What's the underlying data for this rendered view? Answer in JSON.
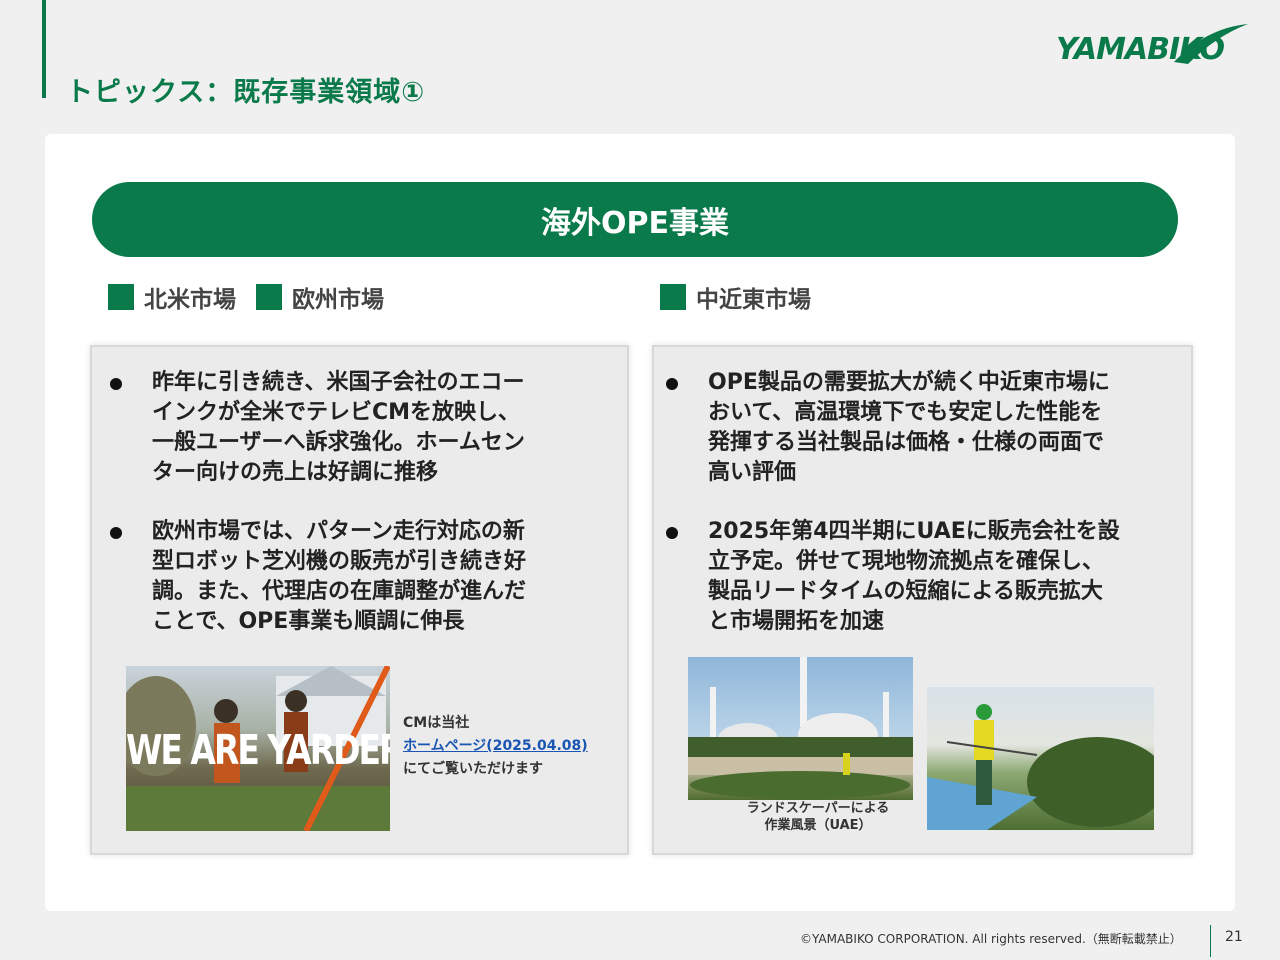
{
  "header": {
    "title": "トピックス：既存事業領域①",
    "logo_text": "YAMABIKO"
  },
  "banner": {
    "title": "海外OPE事業"
  },
  "markets": {
    "north_america": "北米市場",
    "europe": "欧州市場",
    "middle_east": "中近東市場"
  },
  "left_box": {
    "bullets": [
      "昨年に引き続き、米国子会社のエコー\nインクが全米でテレビCMを放映し、\n一般ユーザーへ訴求強化。ホームセン\nター向けの売上は好調に推移",
      "欧州市場では、パターン走行対応の新\n型ロボット芝刈機の販売が引き続き好\n調。また、代理店の在庫調整が進んだ\nことで、OPE事業も順調に伸長"
    ],
    "cm_image_text": "WE ARE YARDERS",
    "cm_note_line1": "CMは当社",
    "cm_note_link": "ホームページ(2025.04.08)",
    "cm_note_line3": "にてご覧いただけます"
  },
  "right_box": {
    "bullets": [
      "OPE製品の需要拡大が続く中近東市場に\nおいて、高温環境下でも安定した性能を\n発揮する当社製品は価格・仕様の両面で\n高い評価",
      "2025年第4四半期にUAEに販売会社を設\n立予定。併せて現地物流拠点を確保し、\n製品リードタイムの短縮による販売拡大\nと市場開拓を加速"
    ],
    "caption_line1": "ランドスケーパーによる",
    "caption_line2": "作業風景（UAE）"
  },
  "footer": {
    "copyright": "©YAMABIKO CORPORATION. All rights reserved.（無断転載禁止）",
    "page_number": "21"
  },
  "colors": {
    "brand_green": "#0b7a4b",
    "link_blue": "#1a55b4"
  }
}
